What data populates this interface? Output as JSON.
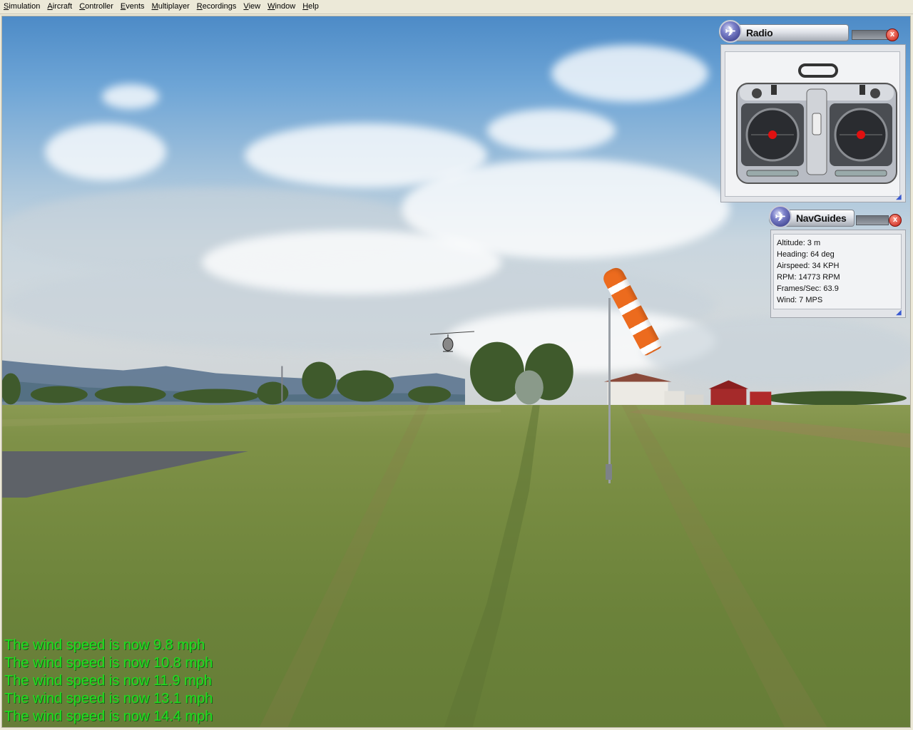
{
  "menubar": {
    "items": [
      {
        "label": "Simulation",
        "accel": "S",
        "rest": "imulation"
      },
      {
        "label": "Aircraft",
        "accel": "A",
        "rest": "ircraft"
      },
      {
        "label": "Controller",
        "accel": "C",
        "rest": "ontroller"
      },
      {
        "label": "Events",
        "accel": "E",
        "rest": "vents"
      },
      {
        "label": "Multiplayer",
        "accel": "M",
        "rest": "ultiplayer"
      },
      {
        "label": "Recordings",
        "accel": "R",
        "rest": "ecordings"
      },
      {
        "label": "View",
        "accel": "V",
        "rest": "iew"
      },
      {
        "label": "Window",
        "accel": "W",
        "rest": "indow"
      },
      {
        "label": "Help",
        "accel": "H",
        "rest": "elp"
      }
    ]
  },
  "radio_panel": {
    "title": "Radio",
    "close": "x",
    "grip": "◢",
    "left_stick": {
      "x": 0.0,
      "y": 0.0
    },
    "right_stick": {
      "x": 0.0,
      "y": 0.0
    }
  },
  "nav_panel": {
    "title": "NavGuides",
    "close": "x",
    "grip": "◢",
    "lines": [
      {
        "text": "Altitude: 3 m"
      },
      {
        "text": "Heading: 64 deg"
      },
      {
        "text": "Airspeed: 34 KPH"
      },
      {
        "text": "RPM: 14773 RPM"
      },
      {
        "text": "Frames/Sec: 63.9"
      },
      {
        "text": "Wind: 7 MPS"
      }
    ]
  },
  "message_log": {
    "color": "#1ee01e",
    "lines": [
      {
        "text": "The wind speed is now 9.8 mph"
      },
      {
        "text": "The wind speed is now 10.8 mph"
      },
      {
        "text": "The wind speed is now 11.9 mph"
      },
      {
        "text": "The wind speed is now 13.1 mph"
      },
      {
        "text": "The wind speed is now 14.4 mph"
      }
    ]
  },
  "scene": {
    "windsock_colors": [
      "#ec6b1e",
      "#ffffff"
    ],
    "sky_color": "#6ea5d6",
    "ground_color": "#758a40"
  }
}
